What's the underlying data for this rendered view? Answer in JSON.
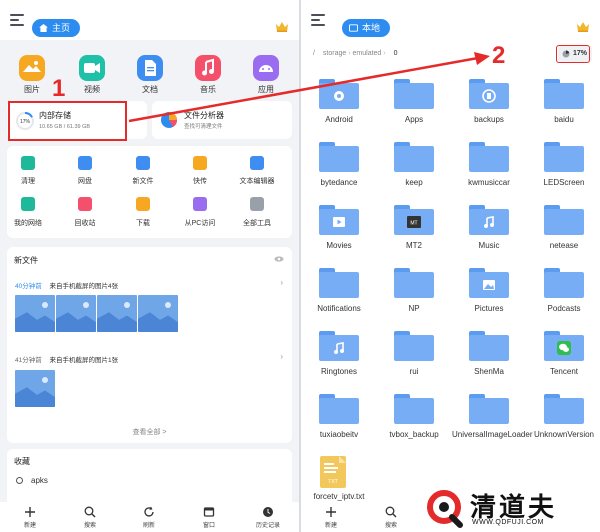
{
  "left": {
    "tab_label": "主页",
    "apps": [
      {
        "label": "图片",
        "icon": "picture-icon",
        "color": "#f6a823"
      },
      {
        "label": "视频",
        "icon": "video-icon",
        "color": "#1fc0a8"
      },
      {
        "label": "文档",
        "icon": "document-icon",
        "color": "#3d8ef0"
      },
      {
        "label": "音乐",
        "icon": "music-icon",
        "color": "#f4506b"
      },
      {
        "label": "应用",
        "icon": "android-icon",
        "color": "#9a6df0"
      }
    ],
    "storage": {
      "title": "内部存储",
      "percent": "17%",
      "usage": "10.65 GB / 61.39 GB",
      "fill": 0.17
    },
    "analyzer": {
      "title": "文件分析器",
      "subtitle": "查找可清理文件"
    },
    "tools_row1": [
      {
        "label": "清理",
        "icon": "broom-icon"
      },
      {
        "label": "网盘",
        "icon": "cloud-icon"
      },
      {
        "label": "新文件",
        "icon": "new-file-icon"
      },
      {
        "label": "快传",
        "icon": "send-icon"
      },
      {
        "label": "文本编辑器",
        "icon": "text-editor-icon"
      }
    ],
    "tools_row2": [
      {
        "label": "我的网络",
        "icon": "router-icon"
      },
      {
        "label": "回收站",
        "icon": "trash-icon"
      },
      {
        "label": "下载",
        "icon": "download-icon"
      },
      {
        "label": "从PC访问",
        "icon": "pc-icon"
      },
      {
        "label": "全部工具",
        "icon": "grid-icon"
      }
    ],
    "new_files": {
      "title": "新文件",
      "group1": {
        "time": "40分钟前",
        "desc": "来自手机截屏的图片4张"
      },
      "group2": {
        "time": "41分钟前",
        "desc": "来自手机截屏的图片1张"
      },
      "view_all": "查看全部 >"
    },
    "favorites": {
      "title": "收藏",
      "item": "apks"
    },
    "nav": [
      "新建",
      "搜索",
      "刷新",
      "窗口",
      "历史记录"
    ]
  },
  "right": {
    "tab_label": "本地",
    "breadcrumb": [
      "/",
      "storage",
      "emulated",
      "0"
    ],
    "storage_percent": "17%",
    "folders": [
      {
        "name": "Android",
        "emblem": "gear"
      },
      {
        "name": "Apps",
        "emblem": ""
      },
      {
        "name": "backups",
        "emblem": "backup"
      },
      {
        "name": "baidu",
        "emblem": ""
      },
      {
        "name": "bytedance",
        "emblem": ""
      },
      {
        "name": "keep",
        "emblem": ""
      },
      {
        "name": "kwmusiccar",
        "emblem": ""
      },
      {
        "name": "LEDScreen",
        "emblem": ""
      },
      {
        "name": "Movies",
        "emblem": "play"
      },
      {
        "name": "MT2",
        "emblem": "mt"
      },
      {
        "name": "Music",
        "emblem": "music"
      },
      {
        "name": "netease",
        "emblem": ""
      },
      {
        "name": "Notifications",
        "emblem": ""
      },
      {
        "name": "NP",
        "emblem": ""
      },
      {
        "name": "Pictures",
        "emblem": "picture"
      },
      {
        "name": "Podcasts",
        "emblem": ""
      },
      {
        "name": "Ringtones",
        "emblem": "music"
      },
      {
        "name": "rui",
        "emblem": ""
      },
      {
        "name": "ShenMa",
        "emblem": ""
      },
      {
        "name": "Tencent",
        "emblem": "wechat"
      },
      {
        "name": "tuxiaobeitv",
        "emblem": ""
      },
      {
        "name": "tvbox_backup",
        "emblem": ""
      },
      {
        "name": "UniversalImageLoader",
        "emblem": ""
      },
      {
        "name": "UnknownVersion",
        "emblem": ""
      }
    ],
    "txt_file": {
      "name": "forcetv_iptv.txt",
      "badge": "TXT"
    },
    "nav": [
      "新建",
      "搜索"
    ]
  },
  "annotations": {
    "step1": "1",
    "step2": "2",
    "color": "#e52a2a"
  },
  "watermark": {
    "brand": "清道夫",
    "url": "WWW.QDFUJI.COM"
  }
}
